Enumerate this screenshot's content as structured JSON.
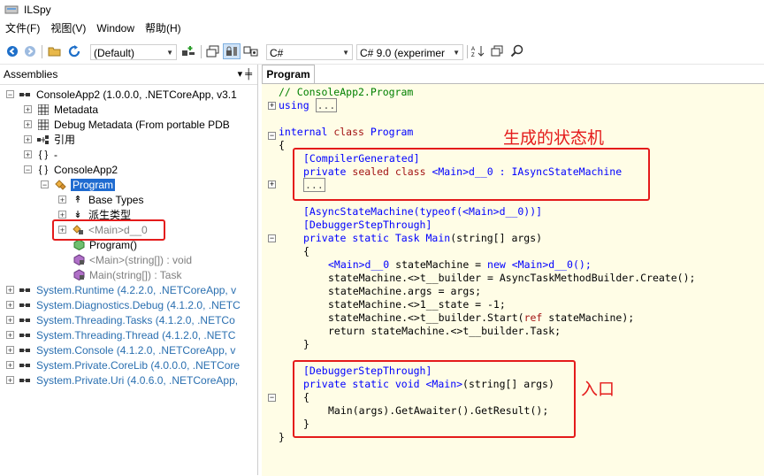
{
  "window": {
    "title": "ILSpy"
  },
  "menu": [
    "文件(F)",
    "视图(V)",
    "Window",
    "帮助(H)"
  ],
  "toolbar": {
    "assembly_list": "(Default)",
    "language": "C#",
    "language_version": "C# 9.0 (experimer"
  },
  "assemblies_panel": {
    "title": "Assemblies",
    "pin": "▾ ╪",
    "nodes": [
      {
        "label": "ConsoleApp2 (1.0.0.0, .NETCoreApp, v3.1"
      },
      {
        "label": "Metadata"
      },
      {
        "label": "Debug Metadata (From portable PDB"
      },
      {
        "label": "引用"
      },
      {
        "label": "-"
      },
      {
        "label": "ConsoleApp2"
      },
      {
        "label": "Program"
      },
      {
        "label": "Base Types"
      },
      {
        "label": "派生类型"
      },
      {
        "label": "<Main>d__0"
      },
      {
        "label": "Program()"
      },
      {
        "label": "<Main>(string[]) : void"
      },
      {
        "label": "Main(string[]) : Task"
      },
      {
        "label": "System.Runtime (4.2.2.0, .NETCoreApp, v"
      },
      {
        "label": "System.Diagnostics.Debug (4.1.2.0, .NETC"
      },
      {
        "label": "System.Threading.Tasks (4.1.2.0, .NETCo"
      },
      {
        "label": "System.Threading.Thread (4.1.2.0, .NETC"
      },
      {
        "label": "System.Console (4.1.2.0, .NETCoreApp, v"
      },
      {
        "label": "System.Private.CoreLib (4.0.0.0, .NETCore"
      },
      {
        "label": "System.Private.Uri (4.0.6.0, .NETCoreApp,"
      }
    ]
  },
  "code_panel": {
    "tab": "Program",
    "lines": [
      "// ConsoleApp2.Program",
      "using",
      "...",
      "internal",
      "class",
      "Program",
      "{",
      "[CompilerGenerated]",
      "private",
      "sealed",
      "class",
      "<Main>d__0",
      ": IAsyncStateMachine",
      "...",
      "[AsyncStateMachine(",
      "typeof",
      "(<Main>d__0))]",
      "[DebuggerStepThrough]",
      "private static Task",
      "Main",
      "(string[] args)",
      "{",
      "<Main>d__0",
      " stateMachine = ",
      "new",
      " <Main>d__0();",
      "stateMachine.<>t__builder = AsyncTaskMethodBuilder.Create();",
      "stateMachine.args = args;",
      "stateMachine.<>1__state = -1;",
      "stateMachine.<>t__builder.Start(",
      "ref",
      " stateMachine);",
      "return stateMachine.<>t__builder.Task;",
      "}",
      "[DebuggerStepThrough]",
      "private static void",
      "<Main>",
      "(string[] args)",
      "{",
      "Main(args).GetAwaiter().GetResult();",
      "}",
      "}"
    ]
  },
  "annotations": {
    "state_machine": "生成的状态机",
    "entry": "入口"
  },
  "colors": {
    "annotation": "#e41b1b",
    "selection": "#1f6bd0",
    "code_bg": "#fffde6"
  }
}
